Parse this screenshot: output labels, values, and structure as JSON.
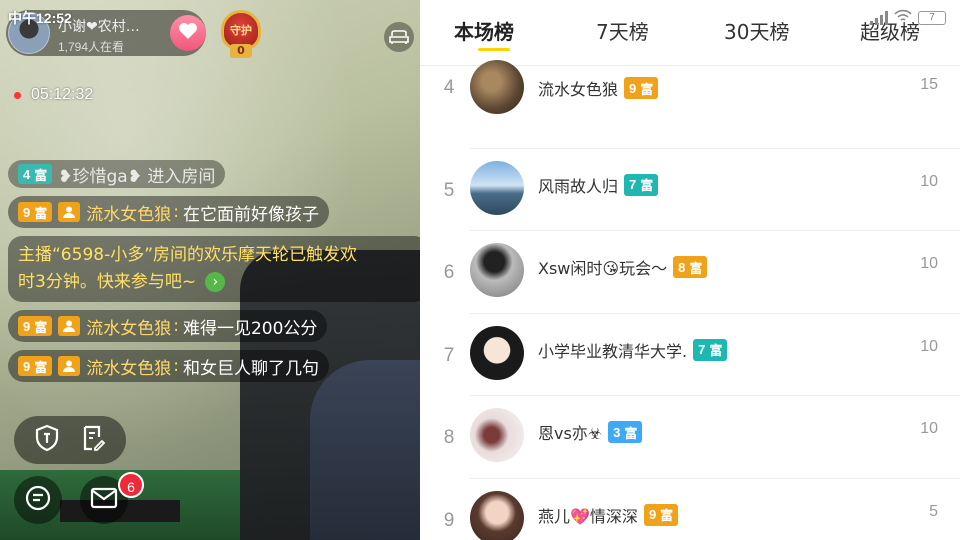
{
  "status_bar": {
    "time": "中午12:52",
    "battery": "7"
  },
  "host": {
    "name": "小谢❤农村…",
    "viewers": "1,794人在看"
  },
  "guard_badge": {
    "label": "守护",
    "sub": "0"
  },
  "live_timer": "05:12:32",
  "chat": [
    {
      "type": "enter",
      "level": "4",
      "level_unit": "富",
      "level_color": "#1fb7b1",
      "text": "❥珍惜ga❥ 进入房间"
    },
    {
      "type": "msg",
      "level": "9",
      "level_unit": "富",
      "user": "流水女色狼",
      "text": "在它面前好像孩子"
    },
    {
      "type": "system",
      "text_line1": "主播“6598-小多”房间的欢乐摩天轮已触发欢",
      "text_line2": "时3分钟。快来参与吧~"
    },
    {
      "type": "msg",
      "level": "9",
      "level_unit": "富",
      "user": "流水女色狼",
      "text": "难得一见200公分"
    },
    {
      "type": "msg",
      "level": "9",
      "level_unit": "富",
      "user": "流水女色狼",
      "text": "和女巨人聊了几句"
    }
  ],
  "message_badge": "6",
  "icons": [
    "guard-shield-icon",
    "edit-doc-icon",
    "chat-bubble-icon",
    "mail-icon",
    "sofa-icon",
    "heart-follow-icon"
  ],
  "leaderboard": {
    "tabs": [
      "本场榜",
      "7天榜",
      "30天榜",
      "超级榜"
    ],
    "active_tab": "本场榜",
    "accent_color": "#ffd200",
    "rows": [
      {
        "rank": "4",
        "name": "流水女色狼",
        "level": "9",
        "level_unit": "富",
        "level_color": "#f0a21a",
        "score": "15"
      },
      {
        "rank": "5",
        "name": "风雨故人归",
        "level": "7",
        "level_unit": "富",
        "level_color": "#1fb7b1",
        "score": "10"
      },
      {
        "rank": "6",
        "name": "Xsw闲时😘玩会～",
        "level": "8",
        "level_unit": "富",
        "level_color": "#f0a21a",
        "score": "10"
      },
      {
        "rank": "7",
        "name": "小学毕业教清华大学.",
        "level": "7",
        "level_unit": "富",
        "level_color": "#1fb7b1",
        "score": "10"
      },
      {
        "rank": "8",
        "name": "恩vs亦☣",
        "level": "3",
        "level_unit": "富",
        "level_color": "#3fa9f5",
        "score": "10"
      },
      {
        "rank": "9",
        "name": "燕儿💖情深深",
        "level": "9",
        "level_unit": "富",
        "level_color": "#f0a21a",
        "score": "5"
      }
    ]
  }
}
